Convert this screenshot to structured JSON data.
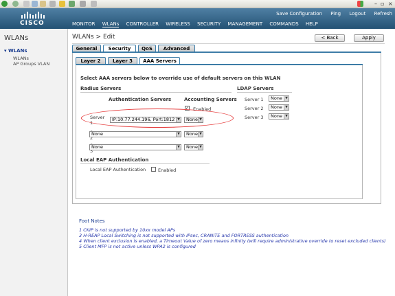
{
  "header": {
    "logo_text": "CISCO",
    "top_links": [
      "Save Configuration",
      "Ping",
      "Logout",
      "Refresh"
    ],
    "nav": [
      "MONITOR",
      "WLANs",
      "CONTROLLER",
      "WIRELESS",
      "SECURITY",
      "MANAGEMENT",
      "COMMANDS",
      "HELP"
    ],
    "active_nav": "WLANs"
  },
  "sidebar": {
    "title": "WLANs",
    "section": "WLANs",
    "items": [
      "WLANs",
      "AP Groups VLAN"
    ]
  },
  "main": {
    "title": "WLANs > Edit",
    "back_label": "< Back",
    "apply_label": "Apply",
    "tabs": [
      "General",
      "Security",
      "QoS",
      "Advanced"
    ],
    "subtabs": [
      "Layer 2",
      "Layer 3",
      "AAA Servers"
    ]
  },
  "aaa": {
    "intro": "Select AAA servers below to override use of default servers on this WLAN",
    "radius_title": "Radius Servers",
    "auth_header": "Authentication Servers",
    "acct_header": "Accounting Servers",
    "enabled_label": "Enabled",
    "servers": [
      {
        "label": "Server 1",
        "auth": "IP:10.77.244.196, Port:1812",
        "acct": "None"
      },
      {
        "label": "Server 2",
        "auth": "None",
        "acct": "None"
      },
      {
        "label": "Server 3",
        "auth": "None",
        "acct": "None"
      }
    ],
    "ldap_title": "LDAP Servers",
    "ldap": [
      {
        "label": "Server 1",
        "value": "None"
      },
      {
        "label": "Server 2",
        "value": "None"
      },
      {
        "label": "Server 3",
        "value": "None"
      }
    ],
    "local_eap_title": "Local EAP Authentication",
    "local_eap_label": "Local EAP Authentication",
    "local_eap_enabled": "Enabled"
  },
  "footnotes": {
    "title": "Foot Notes",
    "notes": [
      "1 CKIP is not supported by 10xx model APs",
      "3 H-REAP Local Switching is not supported with IPsec, CRANITE and FORTRESS authentication",
      "4 When client exclusion is enabled, a Timeout Value of zero means infinity (will require administrative override to reset excluded clients)",
      "5 Client MFP is not active unless WPA2 is configured"
    ]
  },
  "colors": {
    "header": "#2c5a7d",
    "tab_accent": "#3d7ca7",
    "highlight_ellipse": "#e53b3b",
    "footnote": "#2233aa"
  }
}
